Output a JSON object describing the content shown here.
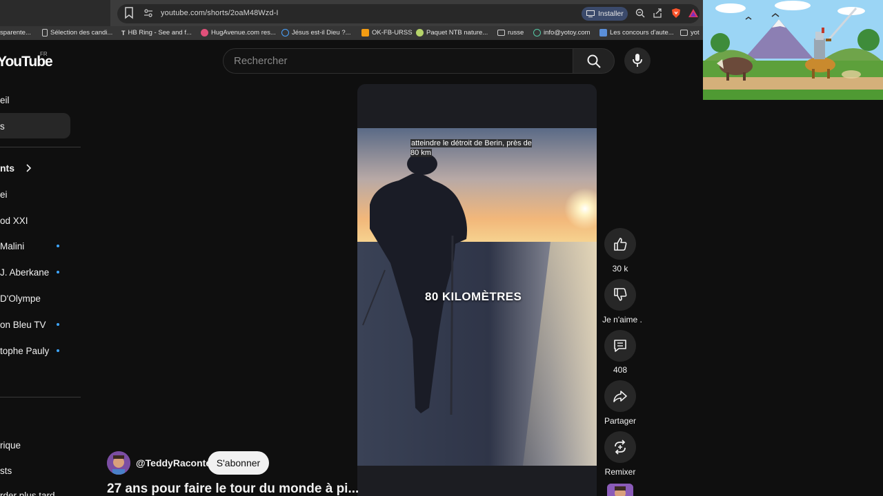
{
  "browser": {
    "url": "youtube.com/shorts/2oaM48Wzd-I",
    "install_label": "Installer",
    "bookmarks": [
      {
        "label": "sparente...",
        "color": ""
      },
      {
        "label": "Sélection des candi...",
        "color": "#cfcfcf"
      },
      {
        "label": "HB Ring - See and f...",
        "color": "#ffffff"
      },
      {
        "label": "HugAvenue.com res...",
        "color": "#e0507a"
      },
      {
        "label": "Jésus est-il Dieu ?...",
        "color": "#4aa3ff"
      },
      {
        "label": "OK-FB-URSS",
        "color": "#f39c12"
      },
      {
        "label": "Paquet NTB nature...",
        "color": "#b5d36a"
      },
      {
        "label": "russe",
        "color": "folder"
      },
      {
        "label": "info@yotoy.com",
        "color": "#55c9a6"
      },
      {
        "label": "Les concours d'aute...",
        "color": "#5b8fd9"
      },
      {
        "label": "yot",
        "color": "folder"
      }
    ]
  },
  "logo": {
    "text": "YouTube",
    "region": "FR"
  },
  "sidebar": {
    "items": [
      {
        "label": "eil"
      },
      {
        "label": "s"
      },
      {
        "label": "nts"
      },
      {
        "label": "ei"
      },
      {
        "label": "od XXI"
      },
      {
        "label": "Malini"
      },
      {
        "label": "J. Aberkane"
      },
      {
        "label": "D'Olympe"
      },
      {
        "label": "on Bleu TV"
      },
      {
        "label": "tophe Pauly"
      },
      {
        "label": "rique"
      },
      {
        "label": "sts"
      },
      {
        "label": "rder plus tard"
      }
    ]
  },
  "search": {
    "placeholder": "Rechercher"
  },
  "video": {
    "subtitle": "atteindre le détroit de Berin, près de 80 km",
    "caption": "80 KILOMÈTRES"
  },
  "actions": {
    "like_count": "30 k",
    "dislike_label": "Je n'aime .",
    "comment_count": "408",
    "share_label": "Partager",
    "remix_label": "Remixer"
  },
  "channel": {
    "name": "@TeddyRaconte",
    "subscribe_label": "S'abonner",
    "title": "27 ans pour faire le tour du monde à pi..."
  },
  "colors": {
    "page_bg": "#0f0f0f",
    "accent_dot": "#3ea6ff",
    "install_bg": "#3b4a6b"
  }
}
